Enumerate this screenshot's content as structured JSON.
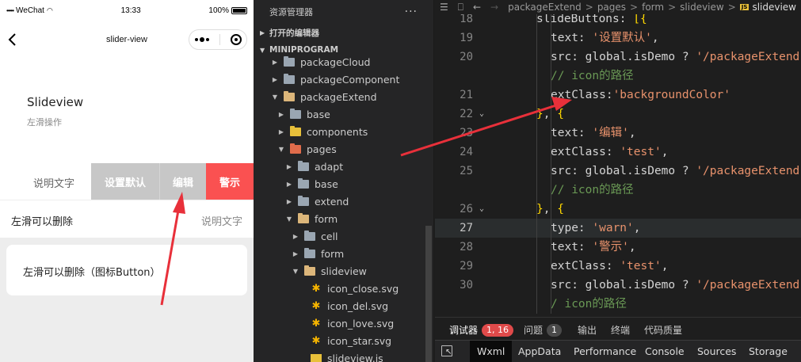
{
  "phone": {
    "status": {
      "carrier": "WeChat",
      "time": "13:33",
      "battery": "100%",
      "signal": "•••••"
    },
    "nav_title": "slider-view",
    "header_title": "Slideview",
    "header_sub": "左滑操作",
    "row1": {
      "text": "说明文字",
      "buttons": [
        "设置默认",
        "编辑",
        "警示"
      ]
    },
    "row2": {
      "title": "左滑可以删除",
      "note": "说明文字"
    },
    "card_text": "左滑可以删除（图标Button）"
  },
  "explorer": {
    "header": "资源管理器",
    "more": "···",
    "open_editors": "打开的编辑器",
    "project": "MINIPROGRAM",
    "tree": [
      {
        "name": "packageCloud",
        "depth": 0,
        "open": false,
        "kind": "folder"
      },
      {
        "name": "packageComponent",
        "depth": 0,
        "open": false,
        "kind": "folder"
      },
      {
        "name": "packageExtend",
        "depth": 0,
        "open": true,
        "kind": "folder"
      },
      {
        "name": "base",
        "depth": 1,
        "open": false,
        "kind": "folder"
      },
      {
        "name": "components",
        "depth": 1,
        "open": false,
        "kind": "folder-yellow"
      },
      {
        "name": "pages",
        "depth": 1,
        "open": true,
        "kind": "folder-red"
      },
      {
        "name": "adapt",
        "depth": 2,
        "open": false,
        "kind": "folder"
      },
      {
        "name": "base",
        "depth": 2,
        "open": false,
        "kind": "folder"
      },
      {
        "name": "extend",
        "depth": 2,
        "open": false,
        "kind": "folder"
      },
      {
        "name": "form",
        "depth": 2,
        "open": true,
        "kind": "folder"
      },
      {
        "name": "cell",
        "depth": 3,
        "open": false,
        "kind": "folder"
      },
      {
        "name": "form",
        "depth": 3,
        "open": false,
        "kind": "folder"
      },
      {
        "name": "slideview",
        "depth": 3,
        "open": true,
        "kind": "folder"
      },
      {
        "name": "icon_close.svg",
        "depth": 4,
        "kind": "svg"
      },
      {
        "name": "icon_del.svg",
        "depth": 4,
        "kind": "svg"
      },
      {
        "name": "icon_love.svg",
        "depth": 4,
        "kind": "svg"
      },
      {
        "name": "icon_star.svg",
        "depth": 4,
        "kind": "svg"
      },
      {
        "name": "slideview.js",
        "depth": 4,
        "kind": "js"
      }
    ]
  },
  "editor": {
    "breadcrumb": [
      "packageExtend",
      "pages",
      "form",
      "slideview"
    ],
    "breadcrumb_file": "slideview",
    "lines": [
      {
        "n": "18",
        "fold": "",
        "indent": 0,
        "tokens": [
          [
            "key",
            "slideButtons: "
          ],
          [
            "br1",
            "[{"
          ]
        ]
      },
      {
        "n": "19",
        "fold": "",
        "indent": 1,
        "tokens": [
          [
            "key",
            "text: "
          ],
          [
            "str",
            "'设置默认'"
          ],
          [
            "key",
            ","
          ]
        ]
      },
      {
        "n": "20",
        "fold": "",
        "indent": 1,
        "tokens": [
          [
            "key",
            "src: global.isDemo ? "
          ],
          [
            "str",
            "'/packageExtend"
          ]
        ]
      },
      {
        "n": "",
        "fold": "",
        "indent": 1,
        "tokens": [
          [
            "com",
            "// icon的路径"
          ]
        ]
      },
      {
        "n": "21",
        "fold": "",
        "indent": 1,
        "tokens": [
          [
            "key",
            "extClass:"
          ],
          [
            "str",
            "'backgroundColor'"
          ]
        ]
      },
      {
        "n": "22",
        "fold": "⌄",
        "indent": 0,
        "tokens": [
          [
            "br1",
            "}"
          ],
          [
            "key",
            ", "
          ],
          [
            "br1",
            "{"
          ]
        ]
      },
      {
        "n": "23",
        "fold": "",
        "indent": 1,
        "tokens": [
          [
            "key",
            "text: "
          ],
          [
            "str",
            "'编辑'"
          ],
          [
            "key",
            ","
          ]
        ]
      },
      {
        "n": "24",
        "fold": "",
        "indent": 1,
        "tokens": [
          [
            "key",
            "extClass: "
          ],
          [
            "str",
            "'test'"
          ],
          [
            "key",
            ","
          ]
        ]
      },
      {
        "n": "25",
        "fold": "",
        "indent": 1,
        "tokens": [
          [
            "key",
            "src: global.isDemo ? "
          ],
          [
            "str",
            "'/packageExtend"
          ]
        ]
      },
      {
        "n": "",
        "fold": "",
        "indent": 1,
        "tokens": [
          [
            "com",
            "// icon的路径"
          ]
        ]
      },
      {
        "n": "26",
        "fold": "⌄",
        "indent": 0,
        "tokens": [
          [
            "br1",
            "}"
          ],
          [
            "key",
            ", "
          ],
          [
            "br1",
            "{"
          ]
        ]
      },
      {
        "n": "27",
        "fold": "",
        "indent": 1,
        "tokens": [
          [
            "key",
            "type: "
          ],
          [
            "str",
            "'warn'"
          ],
          [
            "key",
            ","
          ]
        ],
        "current": true
      },
      {
        "n": "28",
        "fold": "",
        "indent": 1,
        "tokens": [
          [
            "key",
            "text: "
          ],
          [
            "str",
            "'警示'"
          ],
          [
            "key",
            ","
          ]
        ]
      },
      {
        "n": "29",
        "fold": "",
        "indent": 1,
        "tokens": [
          [
            "key",
            "extClass: "
          ],
          [
            "str",
            "'test'"
          ],
          [
            "key",
            ","
          ]
        ]
      },
      {
        "n": "30",
        "fold": "",
        "indent": 1,
        "tokens": [
          [
            "key",
            "src: global.isDemo ? "
          ],
          [
            "str",
            "'/packageExtend"
          ]
        ]
      },
      {
        "n": "",
        "fold": "",
        "indent": 1,
        "tokens": [
          [
            "com",
            "/ icon的路径"
          ]
        ]
      }
    ],
    "panel_tabs": [
      {
        "label": "调试器",
        "badge": "1, 16",
        "badge_kind": "red",
        "active": true
      },
      {
        "label": "问题",
        "badge": "1",
        "badge_kind": "gray"
      },
      {
        "label": "输出"
      },
      {
        "label": "终端"
      },
      {
        "label": "代码质量"
      }
    ],
    "dev_tabs": [
      "Wxml",
      "AppData",
      "Performance",
      "Console",
      "Sources",
      "Storage"
    ],
    "dev_selected": "Wxml"
  },
  "colors": {
    "warn": "#fa5151",
    "swipe_button": "#c7c7c7",
    "annotation_arrow": "#e8303a",
    "editor_bg": "#1e1e1e",
    "explorer_bg": "#252526"
  }
}
